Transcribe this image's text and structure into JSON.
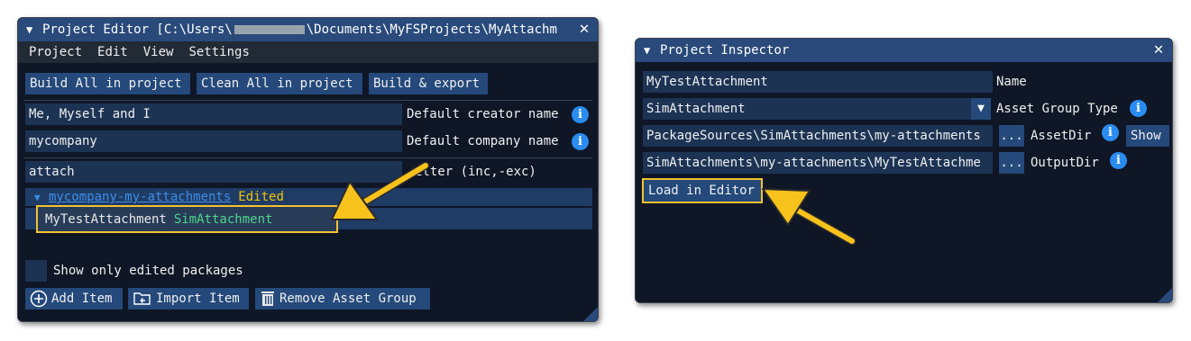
{
  "project_editor": {
    "title_prefix": "Project Editor [C:\\Users\\",
    "title_suffix": "\\Documents\\MyFSProjects\\MyAttachm",
    "menu": [
      "Project",
      "Edit",
      "View",
      "Settings"
    ],
    "toolbar": [
      "Build All in project",
      "Clean All in project",
      "Build & export"
    ],
    "creator": {
      "value": "Me, Myself and I",
      "label": "Default creator name"
    },
    "company": {
      "value": "mycompany",
      "label": "Default company name"
    },
    "filter": {
      "value": "attach",
      "label": "ilter (inc,-exc)"
    },
    "package": {
      "name": "mycompany-my-attachments",
      "status": "Edited"
    },
    "asset": {
      "name": "MyTestAttachment",
      "type": "SimAttachment"
    },
    "show_only_edited": "Show only edited packages",
    "actions": {
      "add": "Add Item",
      "import": "Import Item",
      "remove": "Remove Asset Group"
    }
  },
  "project_inspector": {
    "title": "Project Inspector",
    "name": {
      "value": "MyTestAttachment",
      "label": "Name"
    },
    "asset_group_type": {
      "value": "SimAttachment",
      "label": "Asset Group Type"
    },
    "asset_dir": {
      "value": "PackageSources\\SimAttachments\\my-attachments",
      "browse": "...",
      "label": "AssetDir",
      "show": "Show"
    },
    "output_dir": {
      "value": "SimAttachments\\my-attachments\\MyTestAttachme",
      "browse": "...",
      "label": "OutputDir"
    },
    "load_button": "Load in Editor"
  },
  "colors": {
    "accent": "#294a7a",
    "highlight": "#f2c230",
    "info": "#2a8cf0",
    "edited": "#f2c400",
    "asset_type": "#4fd48a"
  }
}
